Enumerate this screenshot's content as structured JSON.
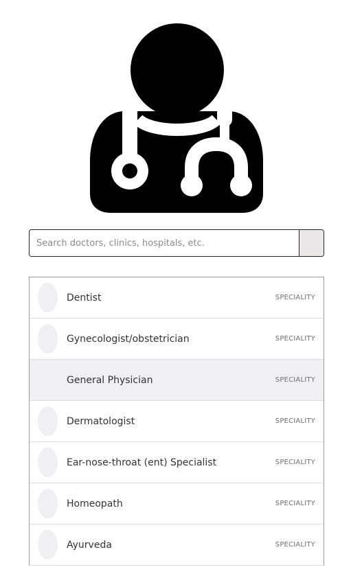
{
  "search": {
    "placeholder": "Search doctors, clinics, hospitals, etc.",
    "value": ""
  },
  "icons": {
    "hero": "doctor-stethoscope-icon"
  },
  "colors": {
    "icon": "#000000",
    "search_button_bg": "#ece8e8",
    "highlight_bg": "#efeff4",
    "avatar_placeholder": "#efeff4"
  },
  "results": [
    {
      "name": "Dentist",
      "type": "SPECIALITY",
      "highlighted": false
    },
    {
      "name": "Gynecologist/obstetrician",
      "type": "SPECIALITY",
      "highlighted": false
    },
    {
      "name": "General Physician",
      "type": "SPECIALITY",
      "highlighted": true
    },
    {
      "name": "Dermatologist",
      "type": "SPECIALITY",
      "highlighted": false
    },
    {
      "name": "Ear-nose-throat (ent) Specialist",
      "type": "SPECIALITY",
      "highlighted": false
    },
    {
      "name": "Homeopath",
      "type": "SPECIALITY",
      "highlighted": false
    },
    {
      "name": "Ayurveda",
      "type": "SPECIALITY",
      "highlighted": false
    }
  ]
}
